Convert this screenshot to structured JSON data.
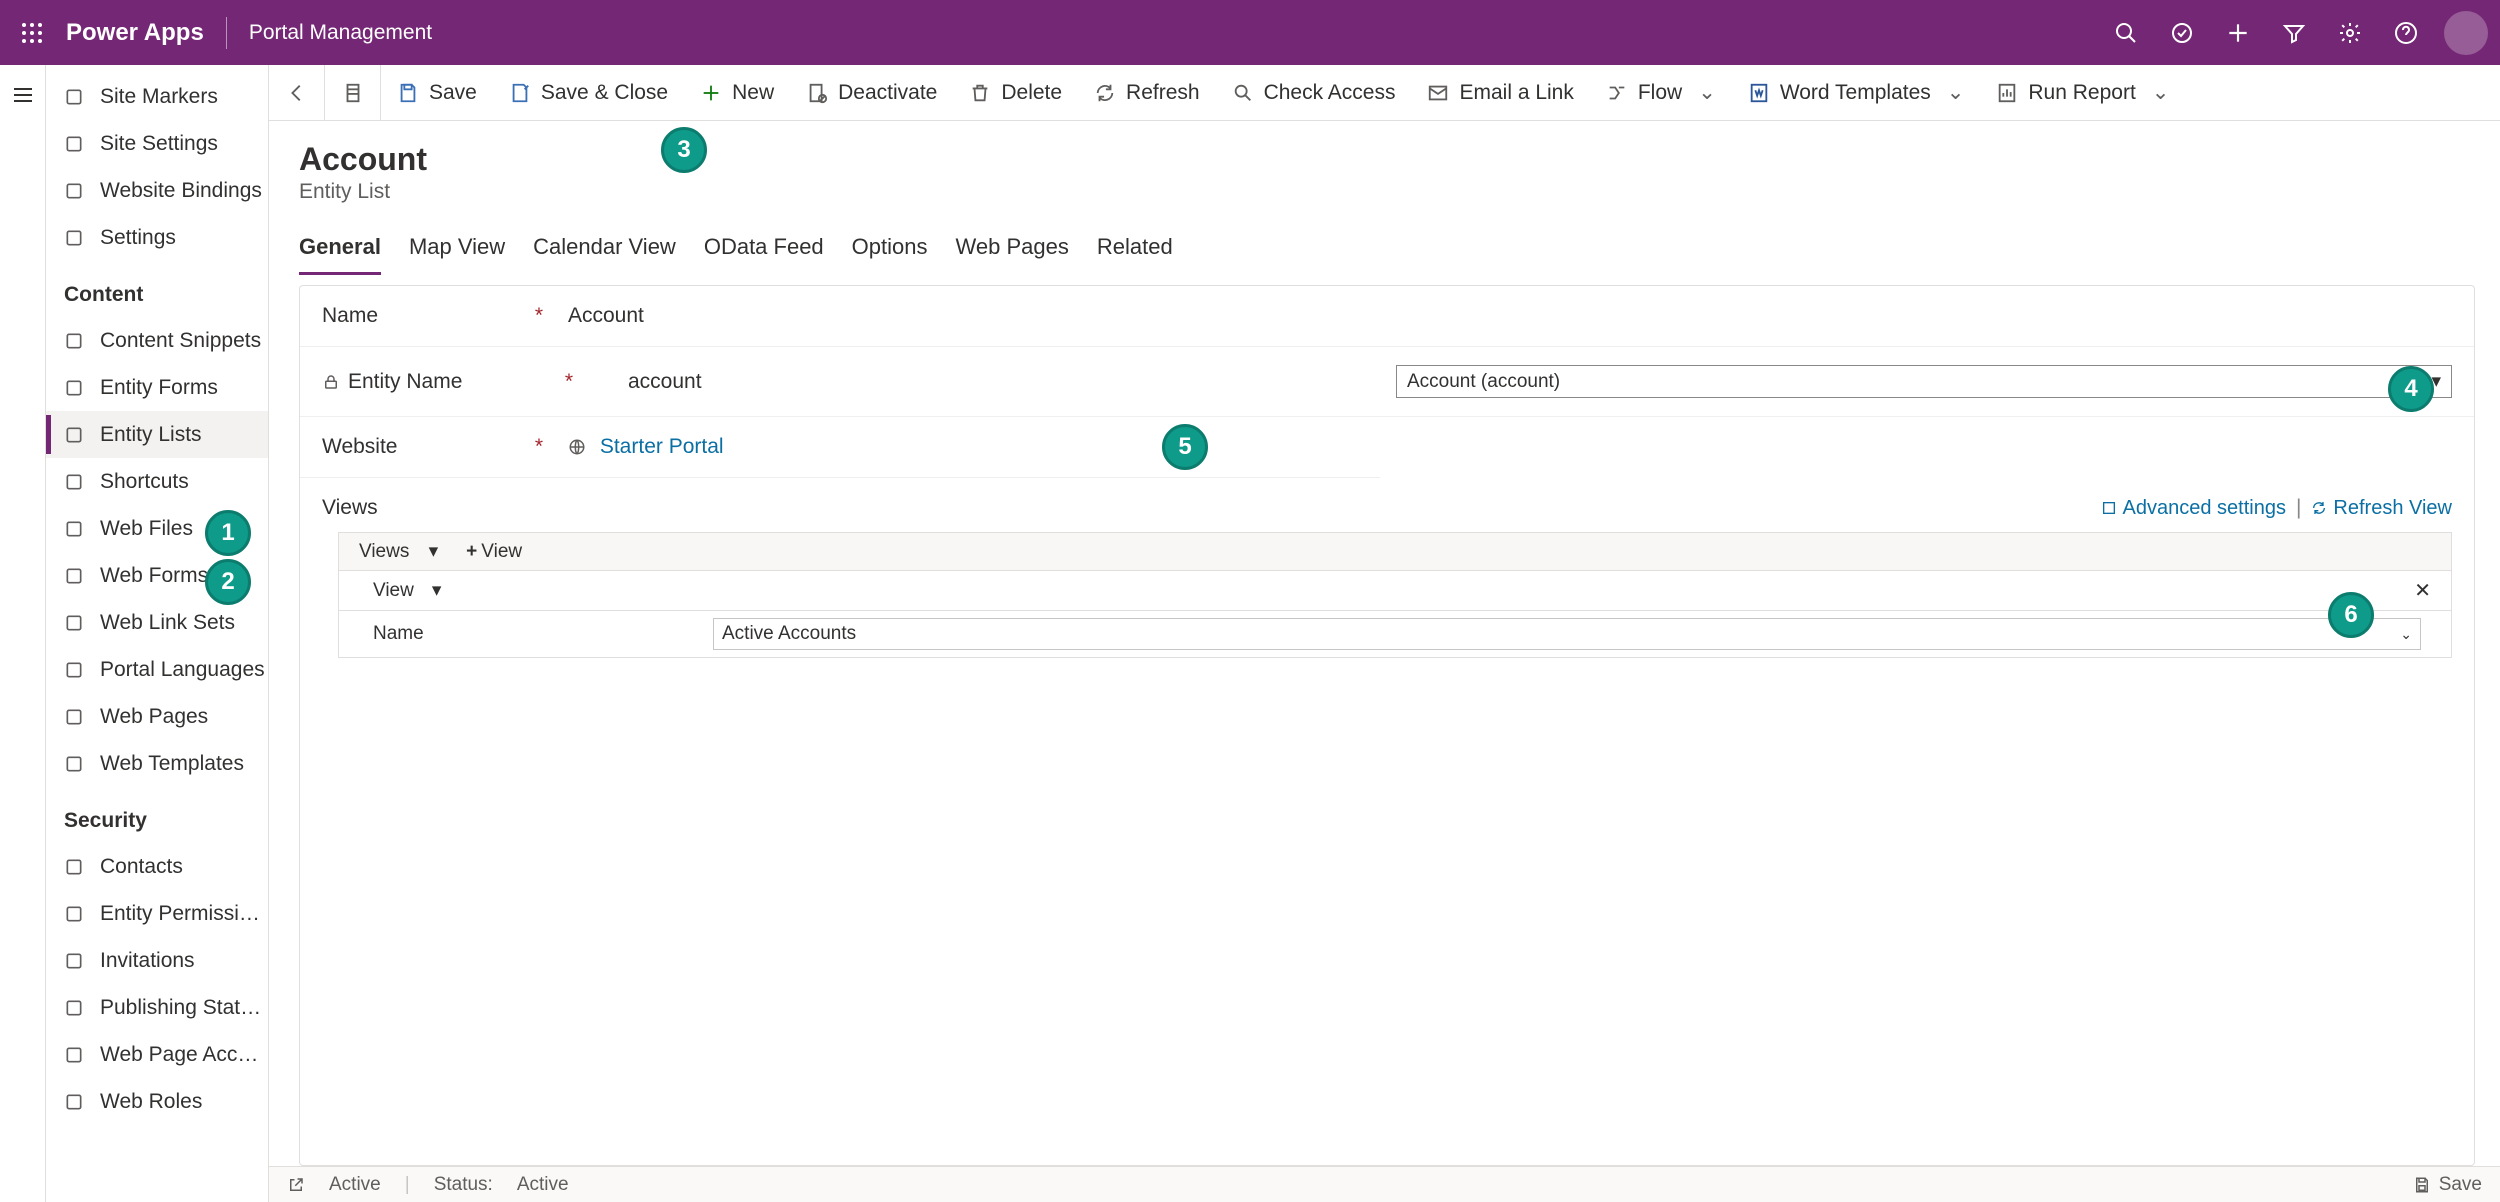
{
  "header": {
    "brand": "Power Apps",
    "context": "Portal Management"
  },
  "sidebar": {
    "top": [
      {
        "label": "Site Markers",
        "icon": "globe"
      },
      {
        "label": "Site Settings",
        "icon": "gear"
      },
      {
        "label": "Website Bindings",
        "icon": "link"
      },
      {
        "label": "Settings",
        "icon": "gear"
      }
    ],
    "sections": [
      {
        "title": "Content",
        "items": [
          {
            "label": "Content Snippets",
            "icon": "doc"
          },
          {
            "label": "Entity Forms",
            "icon": "form"
          },
          {
            "label": "Entity Lists",
            "icon": "list",
            "selected": true
          },
          {
            "label": "Shortcuts",
            "icon": "shortcut"
          },
          {
            "label": "Web Files",
            "icon": "file"
          },
          {
            "label": "Web Forms",
            "icon": "form"
          },
          {
            "label": "Web Link Sets",
            "icon": "lines"
          },
          {
            "label": "Portal Languages",
            "icon": "globe"
          },
          {
            "label": "Web Pages",
            "icon": "page"
          },
          {
            "label": "Web Templates",
            "icon": "doc"
          }
        ]
      },
      {
        "title": "Security",
        "items": [
          {
            "label": "Contacts",
            "icon": "person"
          },
          {
            "label": "Entity Permissions",
            "icon": "shield"
          },
          {
            "label": "Invitations",
            "icon": "mail"
          },
          {
            "label": "Publishing State Tran...",
            "icon": "flow"
          },
          {
            "label": "Web Page Access Co...",
            "icon": "lock"
          },
          {
            "label": "Web Roles",
            "icon": "role"
          }
        ]
      }
    ]
  },
  "commandbar": [
    {
      "kind": "iconbtn",
      "name": "back-button",
      "icon": "back"
    },
    {
      "kind": "iconbtn",
      "name": "record-set-button",
      "icon": "recordset"
    },
    {
      "kind": "btn",
      "name": "save-button",
      "icon": "save",
      "label": "Save"
    },
    {
      "kind": "btn",
      "name": "save-close-button",
      "icon": "saveclose",
      "label": "Save & Close"
    },
    {
      "kind": "btn",
      "name": "new-button",
      "icon": "plus",
      "label": "New"
    },
    {
      "kind": "btn",
      "name": "deactivate-button",
      "icon": "deactivate",
      "label": "Deactivate"
    },
    {
      "kind": "btn",
      "name": "delete-button",
      "icon": "trash",
      "label": "Delete"
    },
    {
      "kind": "btn",
      "name": "refresh-button",
      "icon": "refresh",
      "label": "Refresh"
    },
    {
      "kind": "btn",
      "name": "check-access-button",
      "icon": "search",
      "label": "Check Access"
    },
    {
      "kind": "btn",
      "name": "email-link-button",
      "icon": "mail",
      "label": "Email a Link"
    },
    {
      "kind": "btn",
      "name": "flow-button",
      "icon": "flow",
      "label": "Flow",
      "chevron": true
    },
    {
      "kind": "btn",
      "name": "word-templates-button",
      "icon": "word",
      "label": "Word Templates",
      "chevron": true
    },
    {
      "kind": "btn",
      "name": "run-report-button",
      "icon": "report",
      "label": "Run Report",
      "chevron": true
    }
  ],
  "record": {
    "title": "Account",
    "subtitle": "Entity List",
    "tabs": [
      "General",
      "Map View",
      "Calendar View",
      "OData Feed",
      "Options",
      "Web Pages",
      "Related"
    ],
    "active_tab": 0,
    "fields": {
      "name_label": "Name",
      "name_value": "Account",
      "entity_name_label": "Entity Name",
      "entity_name_value": "account",
      "entity_lookup_value": "Account (account)",
      "website_label": "Website",
      "website_value": "Starter Portal",
      "views_section": "Views",
      "advanced_settings": "Advanced settings",
      "refresh_view": "Refresh View",
      "subgrid": {
        "toolbar_views": "Views",
        "toolbar_add": "View",
        "viewbar_label": "View",
        "row_name_label": "Name",
        "row_name_value": "Active Accounts"
      }
    }
  },
  "statusbar": {
    "state": "Active",
    "status_label": "Status:",
    "status_value": "Active",
    "save_label": "Save"
  },
  "callouts": {
    "1": "1",
    "2": "2",
    "3": "3",
    "4": "4",
    "5": "5",
    "6": "6"
  }
}
